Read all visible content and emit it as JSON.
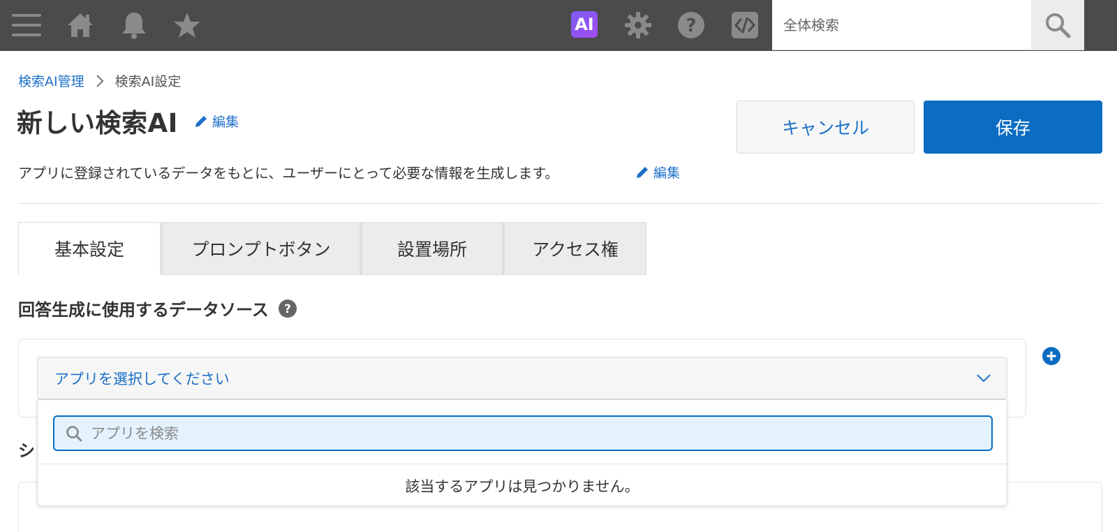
{
  "topbar": {
    "icons": [
      "menu-icon",
      "home-icon",
      "bell-icon",
      "star-icon",
      "ai-icon",
      "gear-icon",
      "help-icon",
      "code-icon"
    ],
    "ai_badge": "AI",
    "search": {
      "placeholder": "全体検索"
    },
    "colors": {
      "bar": "#4b4b4b",
      "icon": "#8a8a8a",
      "ai_gradient_start": "#7c5cf5",
      "ai_gradient_end": "#a24cf0"
    }
  },
  "breadcrumb": {
    "parent": "検索AI管理",
    "current": "検索AI設定"
  },
  "header": {
    "title": "新しい検索AI",
    "edit_label": "編集",
    "description": "アプリに登録されているデータをもとに、ユーザーにとって必要な情報を生成します。",
    "cancel_label": "キャンセル",
    "save_label": "保存"
  },
  "tabs": [
    {
      "label": "基本設定",
      "active": true
    },
    {
      "label": "プロンプトボタン",
      "active": false
    },
    {
      "label": "設置場所",
      "active": false
    },
    {
      "label": "アクセス権",
      "active": false
    }
  ],
  "section": {
    "title": "回答生成に使用するデータソース",
    "select_placeholder": "アプリを選択してください",
    "dropdown": {
      "search_placeholder": "アプリを検索",
      "empty_message": "該当するアプリは見つかりません。"
    },
    "next_section_title_visible": "シ"
  },
  "colors": {
    "accent": "#1e70c8",
    "primary_button": "#0b6cc1",
    "search_focus_bg": "#e3f2fd"
  }
}
